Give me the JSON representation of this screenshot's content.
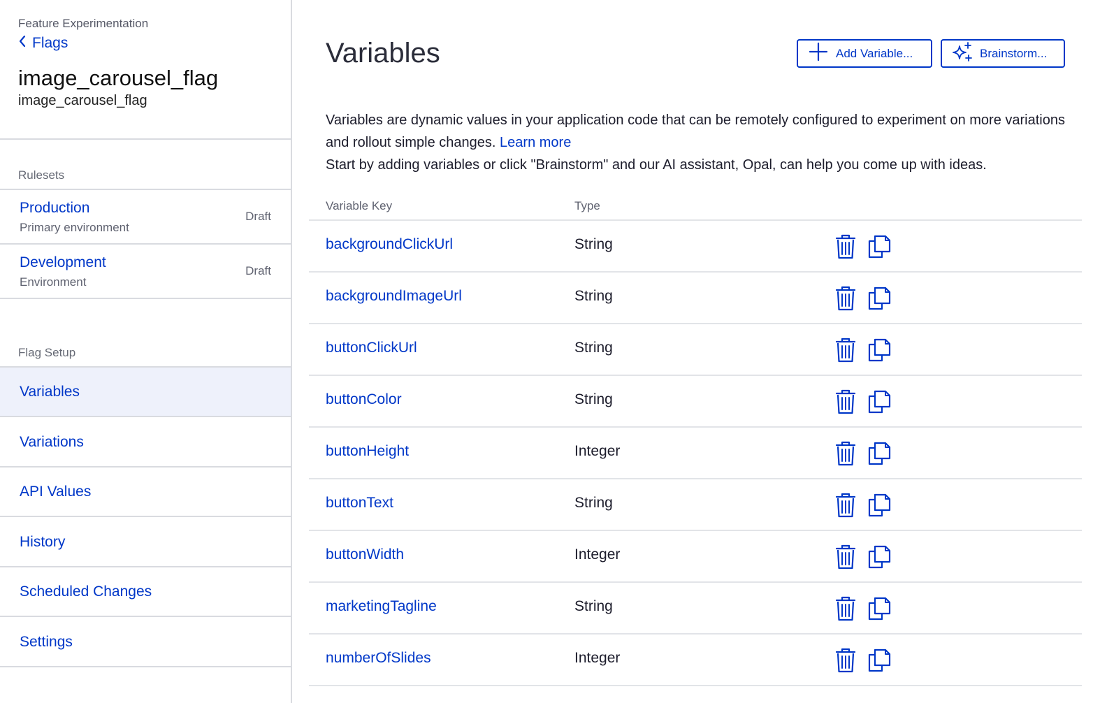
{
  "sidebar": {
    "app_name": "Feature Experimentation",
    "back_label": "Flags",
    "flag_title": "image_carousel_flag",
    "flag_key": "image_carousel_flag",
    "rulesets_label": "Rulesets",
    "rulesets": [
      {
        "name": "Production",
        "subtitle": "Primary environment",
        "status": "Draft"
      },
      {
        "name": "Development",
        "subtitle": "Environment",
        "status": "Draft"
      }
    ],
    "setup_label": "Flag Setup",
    "nav": [
      {
        "label": "Variables",
        "active": true
      },
      {
        "label": "Variations"
      },
      {
        "label": "API Values"
      },
      {
        "label": "History"
      },
      {
        "label": "Scheduled Changes"
      },
      {
        "label": "Settings"
      }
    ]
  },
  "main": {
    "title": "Variables",
    "add_button": "Add Variable...",
    "brainstorm_button": "Brainstorm...",
    "description_1": "Variables are dynamic values in your application code that can be remotely configured to experiment on more variations and rollout simple changes.",
    "learn_more": "Learn more",
    "description_2": "Start by adding variables or click \"Brainstorm\" and our AI assistant, Opal, can help you come up with ideas.",
    "columns": {
      "key": "Variable Key",
      "type": "Type"
    },
    "rows": [
      {
        "key": "backgroundClickUrl",
        "type": "String"
      },
      {
        "key": "backgroundImageUrl",
        "type": "String"
      },
      {
        "key": "buttonClickUrl",
        "type": "String"
      },
      {
        "key": "buttonColor",
        "type": "String"
      },
      {
        "key": "buttonHeight",
        "type": "Integer"
      },
      {
        "key": "buttonText",
        "type": "String"
      },
      {
        "key": "buttonWidth",
        "type": "Integer"
      },
      {
        "key": "marketingTagline",
        "type": "String"
      },
      {
        "key": "numberOfSlides",
        "type": "Integer"
      }
    ],
    "icons": {
      "delete": "trash-icon",
      "copy": "copy-icon",
      "add": "plus-icon",
      "brainstorm": "sparkles-icon"
    }
  },
  "colors": {
    "accent": "#0037c8",
    "active_bg": "#eef1fb",
    "border": "#d9dbe0"
  }
}
